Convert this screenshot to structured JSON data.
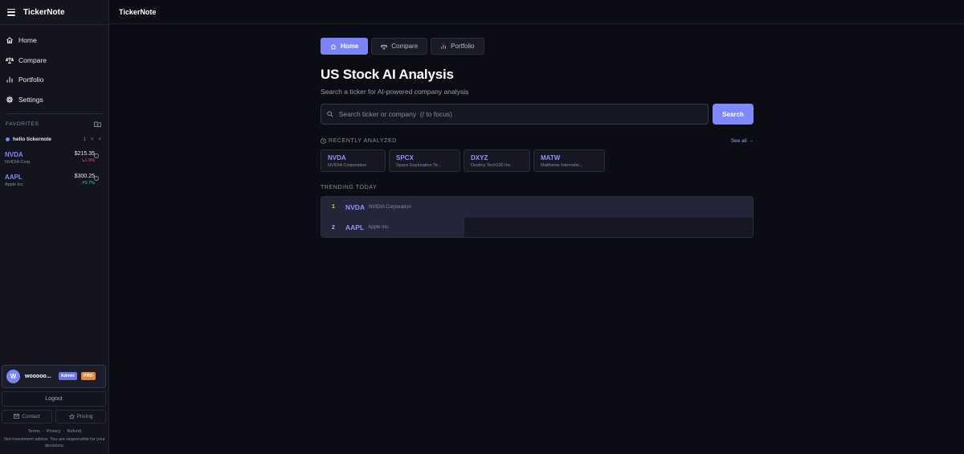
{
  "app": {
    "title": "TickerNote"
  },
  "sidebar": {
    "nav": [
      {
        "label": "Home",
        "icon": "home-icon"
      },
      {
        "label": "Compare",
        "icon": "scale-icon"
      },
      {
        "label": "Portfolio",
        "icon": "bar-chart-icon"
      },
      {
        "label": "Settings",
        "icon": "gear-icon"
      }
    ],
    "favorites_label": "FAVORITES",
    "group": {
      "name": "hello tickernote",
      "count": "1",
      "chevron": "˅",
      "close": "×"
    },
    "favorites": [
      {
        "ticker": "NVDA",
        "name": "NVIDIA Corp",
        "price": "$215.35",
        "change": "↘1.9%",
        "direction": "down"
      },
      {
        "ticker": "AAPL",
        "name": "Apple Inc",
        "price": "$300.25",
        "change": "↗0.7%",
        "direction": "up"
      }
    ],
    "user": {
      "initial": "W",
      "name": "wooooo...",
      "role_badge": "Admin",
      "plan_badge": "PRO"
    },
    "logout_label": "Logout",
    "contact_label": "Contact",
    "pricing_label": "Pricing",
    "legal": {
      "terms": "Terms",
      "privacy": "Privacy",
      "refund": "Refund",
      "sep": "·"
    },
    "disclaimer": "Not investment advice. You are responsible for your decisions."
  },
  "main": {
    "tabs": [
      {
        "label": "Home",
        "icon": "home-icon",
        "active": true
      },
      {
        "label": "Compare",
        "icon": "scale-icon",
        "active": false
      },
      {
        "label": "Portfolio",
        "icon": "bar-chart-icon",
        "active": false
      }
    ],
    "title": "US Stock AI Analysis",
    "subtitle": "Search a ticker for AI-powered company analysis",
    "search": {
      "placeholder": "Search ticker or company  (/ to focus)",
      "value": "",
      "button_label": "Search"
    },
    "recent": {
      "label": "RECENTLY ANALYZED",
      "see_all": "See all →",
      "items": [
        {
          "ticker": "NVDA",
          "name": "NVIDIA Corporation"
        },
        {
          "ticker": "SPCX",
          "name": "Space Exploration Te..."
        },
        {
          "ticker": "DXYZ",
          "name": "Destiny Tech100 Inc."
        },
        {
          "ticker": "MATW",
          "name": "Matthews Internatio..."
        }
      ]
    },
    "trending": {
      "label": "TRENDING TODAY",
      "items": [
        {
          "rank": "1",
          "ticker": "NVDA",
          "name": "NVIDIA Corporation"
        },
        {
          "rank": "2",
          "ticker": "AAPL",
          "name": "Apple Inc."
        }
      ]
    }
  },
  "colors": {
    "accent": "#7b84f6",
    "link": "#8c94ff",
    "negative": "#f05a6a",
    "positive": "#3fd29a",
    "pro": "#e8883a",
    "rank1": "#f2c94c"
  }
}
